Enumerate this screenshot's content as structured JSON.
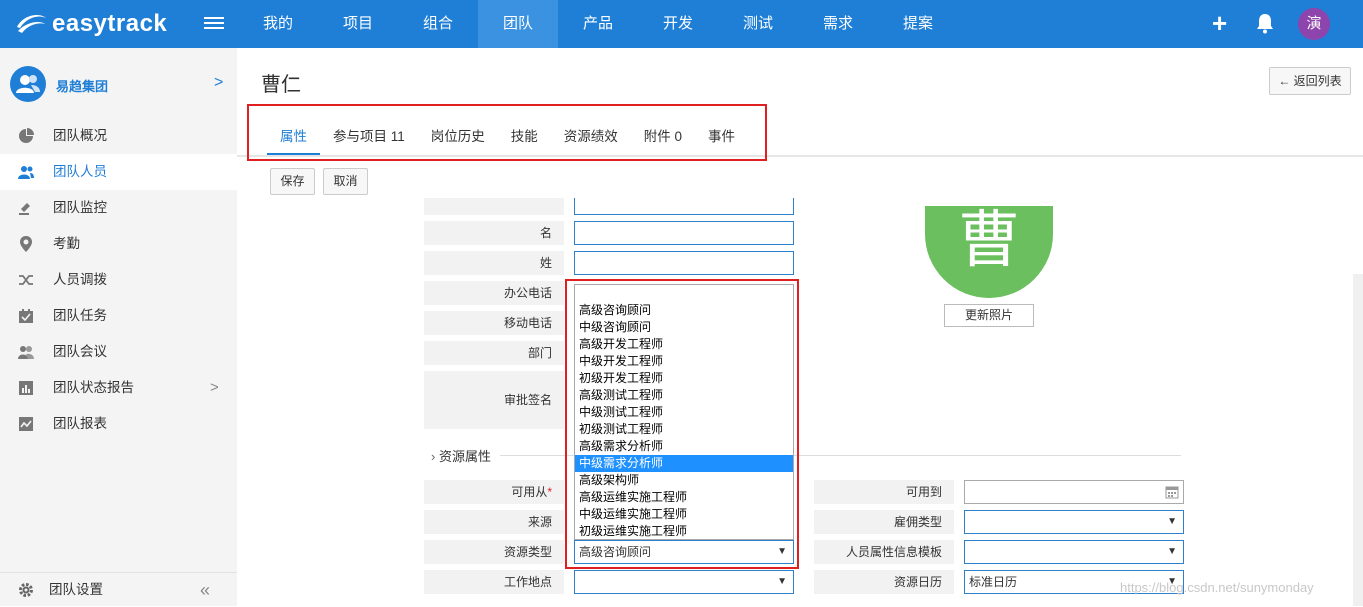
{
  "brand": {
    "name": "easytrack"
  },
  "nav": [
    "我的",
    "项目",
    "组合",
    "团队",
    "产品",
    "开发",
    "测试",
    "需求",
    "提案"
  ],
  "user": {
    "avatar_text": "演"
  },
  "sidebar": {
    "org_name": "易趋集团",
    "items": [
      {
        "label": "团队概况",
        "icon": "pie-chart-icon"
      },
      {
        "label": "团队人员",
        "icon": "users-icon"
      },
      {
        "label": "团队监控",
        "icon": "gavel-icon"
      },
      {
        "label": "考勤",
        "icon": "location-pin-icon"
      },
      {
        "label": "人员调拨",
        "icon": "shuffle-icon"
      },
      {
        "label": "团队任务",
        "icon": "calendar-check-icon"
      },
      {
        "label": "团队会议",
        "icon": "meeting-icon"
      },
      {
        "label": "团队状态报告",
        "icon": "bar-chart-icon"
      },
      {
        "label": "团队报表",
        "icon": "report-icon"
      }
    ],
    "settings_label": "团队设置"
  },
  "page": {
    "title": "曹仁",
    "back_label": "返回列表",
    "tabs": [
      "属性",
      "参与项目 11",
      "岗位历史",
      "技能",
      "资源绩效",
      "附件 0",
      "事件"
    ],
    "save_label": "保存",
    "cancel_label": "取消"
  },
  "form": {
    "labels": {
      "first_name": "名",
      "last_name": "姓",
      "office_phone": "办公电话",
      "mobile_phone": "移动电话",
      "department": "部门",
      "signature": "审批签名",
      "available_from": "可用从",
      "available_from_required": "*",
      "source": "来源",
      "resource_type": "资源类型",
      "work_location": "工作地点",
      "available_to": "可用到",
      "employment_type": "雇佣类型",
      "attr_template": "人员属性信息模板",
      "resource_calendar": "资源日历"
    },
    "resource_type_value": "高级咨询顾问",
    "resource_calendar_value": "标准日历",
    "photo_text": "曹",
    "photo_button": "更新照片",
    "section_title": "资源属性"
  },
  "dropdown": {
    "options": [
      "",
      "高级咨询顾问",
      "中级咨询顾问",
      "高级开发工程师",
      "中级开发工程师",
      "初级开发工程师",
      "高级测试工程师",
      "中级测试工程师",
      "初级测试工程师",
      "高级需求分析师",
      "中级需求分析师",
      "高级架构师",
      "高级运维实施工程师",
      "中级运维实施工程师",
      "初级运维实施工程师"
    ],
    "highlighted": "中级需求分析师"
  },
  "watermark": "https://blog.csdn.net/sunymonday",
  "colors": {
    "primary": "#1f7fd6",
    "highlight": "#e02020",
    "avatar": "#6bbf5e",
    "user_avatar": "#8e44ad"
  }
}
